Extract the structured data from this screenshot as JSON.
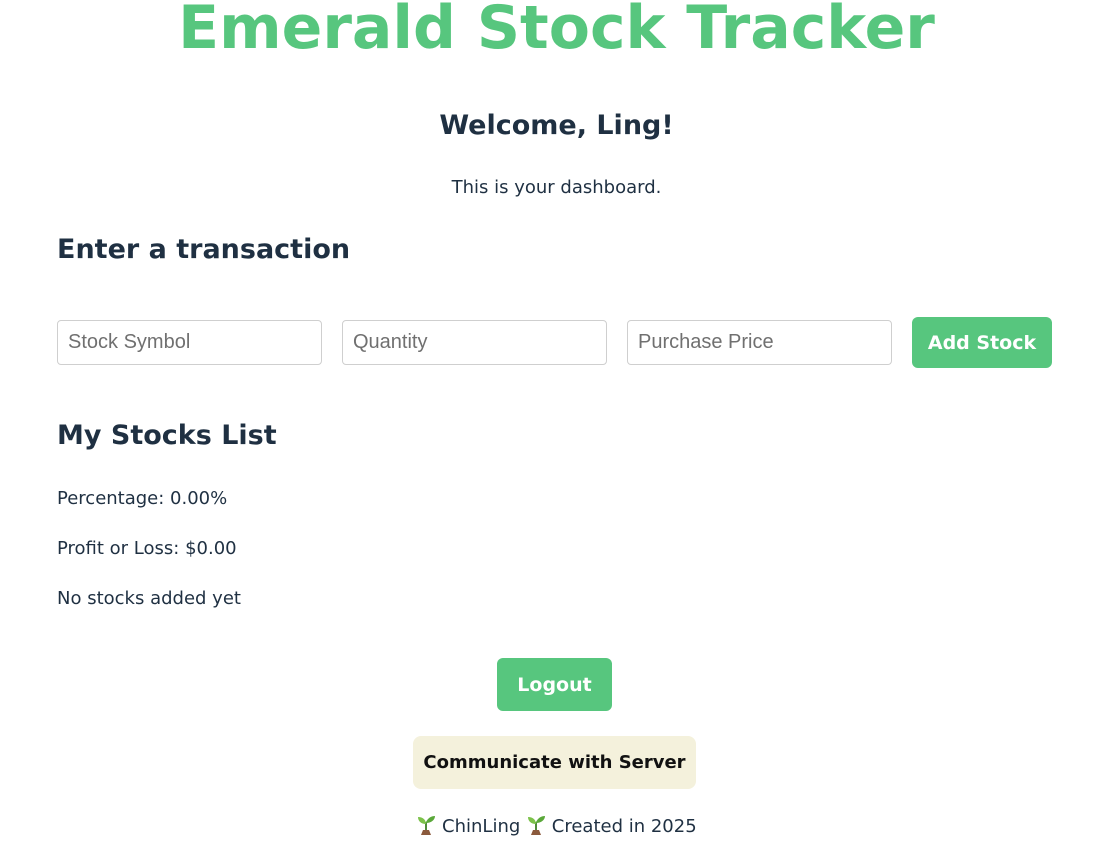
{
  "header": {
    "app_title": "Emerald Stock Tracker",
    "welcome": "Welcome, Ling!",
    "dashboard_text": "This is your dashboard."
  },
  "transaction": {
    "heading": "Enter a transaction",
    "symbol_placeholder": "Stock Symbol",
    "quantity_placeholder": "Quantity",
    "price_placeholder": "Purchase Price",
    "add_button_label": "Add Stock"
  },
  "stocks": {
    "heading": "My Stocks List",
    "percentage": "Percentage: 0.00%",
    "profit_loss": "Profit or Loss: $0.00",
    "empty_message": "No stocks added yet"
  },
  "actions": {
    "logout_label": "Logout",
    "server_label": "Communicate with Server"
  },
  "footer": {
    "author": "ChinLing",
    "created": "Created in 2025",
    "icon": "seedling-icon"
  },
  "colors": {
    "accent": "#57c67e",
    "text": "#1f3042",
    "server_button_bg": "#f4f1dc"
  }
}
